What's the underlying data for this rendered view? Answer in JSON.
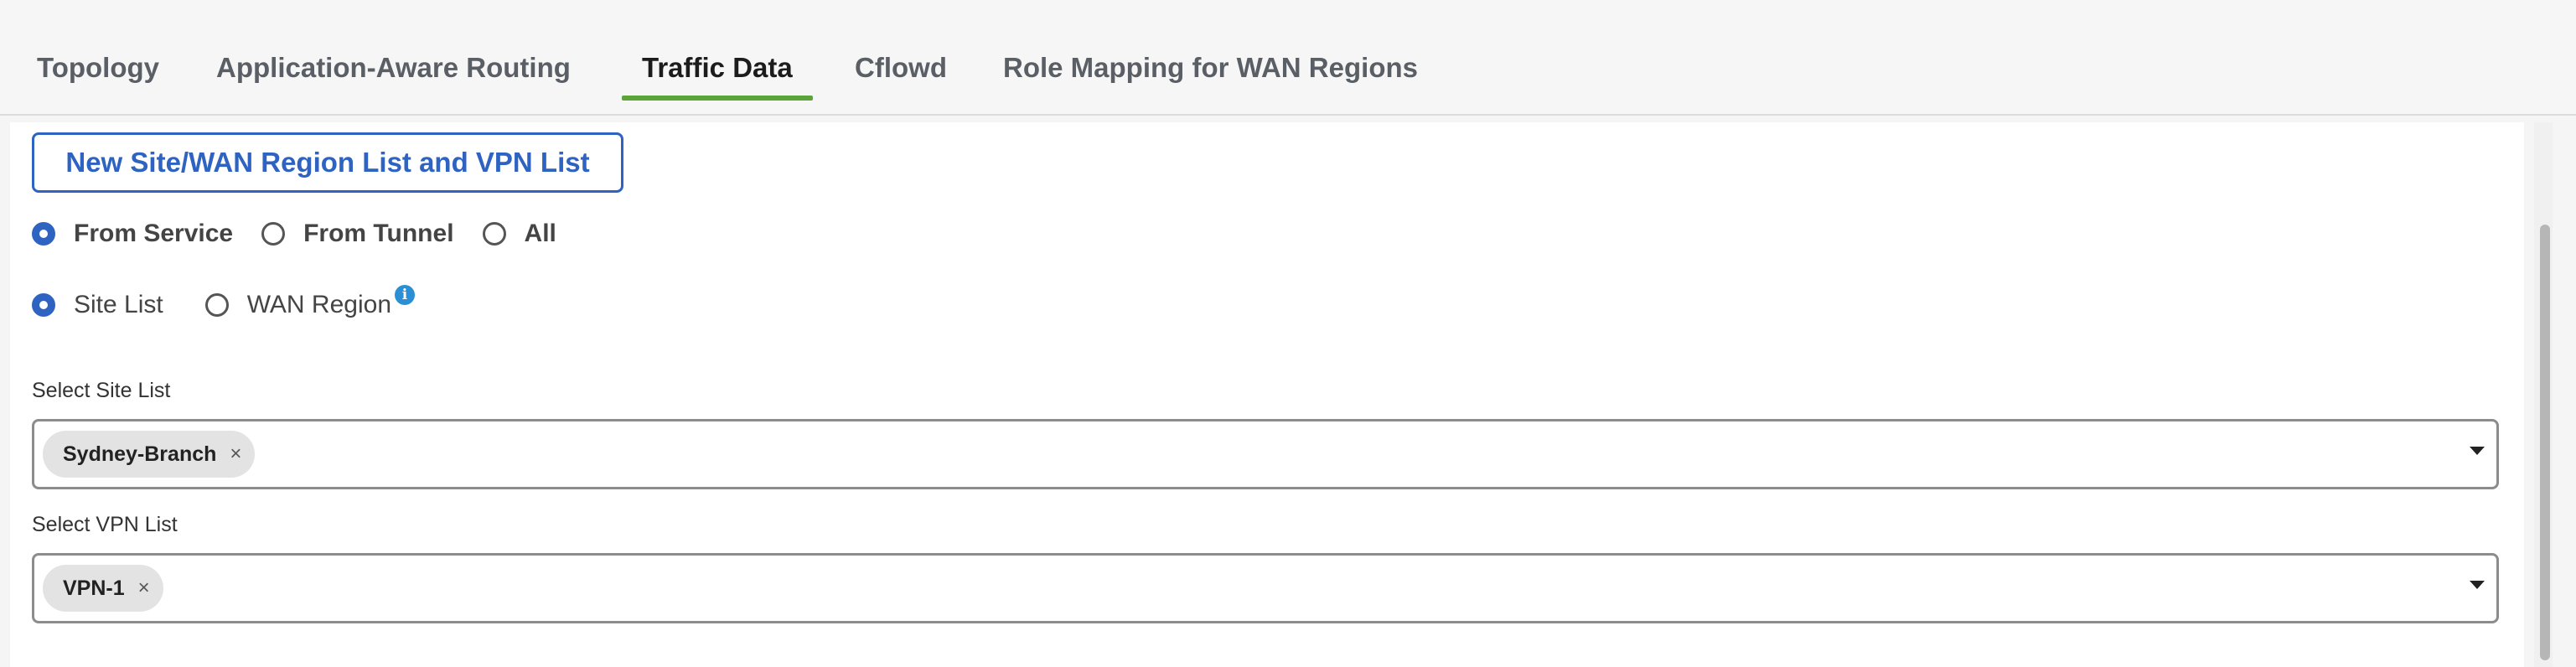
{
  "tabs": [
    {
      "label": "Topology",
      "active": false
    },
    {
      "label": "Application-Aware Routing",
      "active": false
    },
    {
      "label": "Traffic Data",
      "active": true
    },
    {
      "label": "Cflowd",
      "active": false
    },
    {
      "label": "Role Mapping for WAN Regions",
      "active": false
    }
  ],
  "new_list_button": "New Site/WAN Region List and VPN List",
  "direction": {
    "options": [
      "From Service",
      "From Tunnel",
      "All"
    ],
    "selected": "From Service"
  },
  "scope": {
    "options": [
      "Site List",
      "WAN Region"
    ],
    "selected": "Site List",
    "info_icon": "i"
  },
  "site_list": {
    "label": "Select Site List",
    "chips": [
      "Sydney-Branch"
    ],
    "remove_glyph": "×"
  },
  "vpn_list": {
    "label": "Select VPN List",
    "chips": [
      "VPN-1"
    ],
    "remove_glyph": "×"
  },
  "colors": {
    "accent_blue": "#2f63c2",
    "active_tab_underline": "#5aa43a",
    "info_blue": "#2b8fd6"
  }
}
